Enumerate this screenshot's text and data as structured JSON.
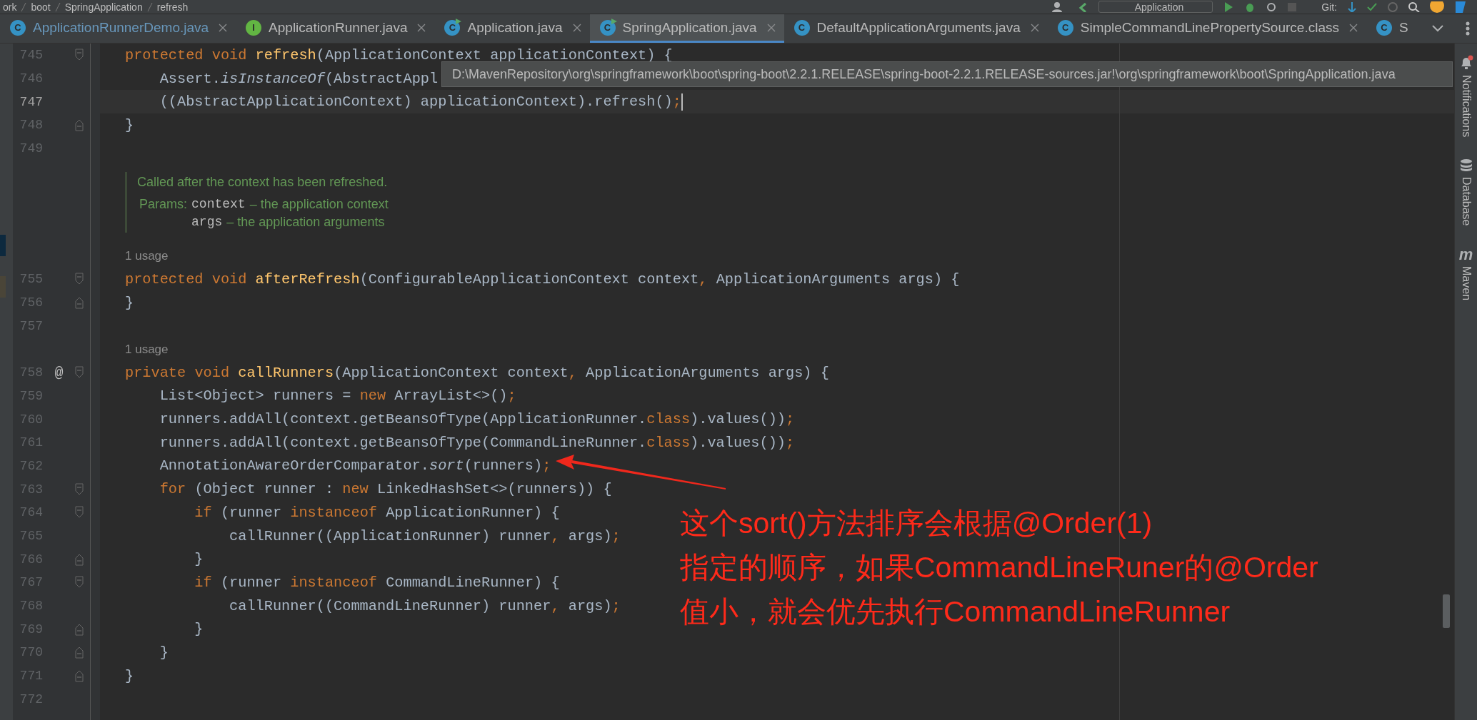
{
  "breadcrumbs": [
    "ork",
    "boot",
    "SpringApplication",
    "refresh"
  ],
  "toolbar": {
    "run_config": "Application",
    "vcs_label": "Git:"
  },
  "tabs": [
    {
      "label": "ApplicationRunnerDemo.java",
      "icon": "C",
      "kind": "class",
      "selected": false,
      "closable": true
    },
    {
      "label": "ApplicationRunner.java",
      "icon": "I",
      "kind": "interface",
      "selected": false,
      "closable": true
    },
    {
      "label": "Application.java",
      "icon": "C",
      "kind": "runnable",
      "selected": false,
      "closable": true
    },
    {
      "label": "SpringApplication.java",
      "icon": "C",
      "kind": "runnable",
      "selected": true,
      "closable": true
    },
    {
      "label": "DefaultApplicationArguments.java",
      "icon": "C",
      "kind": "class",
      "selected": false,
      "closable": true
    },
    {
      "label": "SimpleCommandLinePropertySource.class",
      "icon": "C",
      "kind": "class",
      "selected": false,
      "closable": true
    },
    {
      "label": "S",
      "icon": "C",
      "kind": "class",
      "selected": false,
      "closable": false
    }
  ],
  "tooltip": "D:\\MavenRepository\\org\\springframework\\boot\\spring-boot\\2.2.1.RELEASE\\spring-boot-2.2.1.RELEASE-sources.jar!\\org\\springframework\\boot\\SpringApplication.java",
  "editor": {
    "lines": [
      {
        "kind": "code",
        "number": "745",
        "fold_start": true,
        "fold_end": false,
        "current": false,
        "tokens": [
          {
            "kind": "keyword",
            "text": "protected "
          },
          {
            "kind": "keyword",
            "text": "void "
          },
          {
            "kind": "method",
            "text": "refresh"
          },
          {
            "kind": "plain",
            "text": "(ApplicationContext applicationContext) {"
          }
        ]
      },
      {
        "kind": "code",
        "number": "746",
        "fold_start": false,
        "fold_end": false,
        "current": false,
        "tokens": [
          {
            "kind": "plain",
            "text": "    Assert."
          },
          {
            "kind": "static",
            "text": "isInstanceOf"
          },
          {
            "kind": "plain",
            "text": "(AbstractAppl"
          }
        ]
      },
      {
        "kind": "code",
        "number": "747",
        "fold_start": false,
        "fold_end": false,
        "current": true,
        "tokens": [
          {
            "kind": "plain",
            "text": "    ((AbstractApplicationContext) applicationContext).refresh()"
          },
          {
            "kind": "keyword",
            "text": ";"
          }
        ]
      },
      {
        "kind": "code",
        "number": "748",
        "fold_start": false,
        "fold_end": true,
        "current": false,
        "tokens": [
          {
            "kind": "plain",
            "text": "}"
          }
        ]
      },
      {
        "kind": "code",
        "number": "749",
        "fold_start": false,
        "fold_end": false,
        "current": false
      },
      {
        "kind": "doc",
        "summary": "Called after the context has been refreshed.",
        "params_label": "Params:",
        "params": [
          {
            "name": "context",
            "description": "– the application context"
          },
          {
            "name": "args",
            "description": "– the application arguments"
          }
        ]
      },
      {
        "kind": "usage",
        "text": "1 usage"
      },
      {
        "kind": "code",
        "number": "755",
        "fold_start": true,
        "fold_end": false,
        "current": false,
        "tokens": [
          {
            "kind": "keyword",
            "text": "protected "
          },
          {
            "kind": "keyword",
            "text": "void "
          },
          {
            "kind": "method",
            "text": "afterRefresh"
          },
          {
            "kind": "plain",
            "text": "(ConfigurableApplicationContext context"
          },
          {
            "kind": "keyword",
            "text": ", "
          },
          {
            "kind": "plain",
            "text": "ApplicationArguments args) {"
          }
        ]
      },
      {
        "kind": "code",
        "number": "756",
        "fold_start": false,
        "fold_end": true,
        "current": false,
        "tokens": [
          {
            "kind": "plain",
            "text": "}"
          }
        ]
      },
      {
        "kind": "code",
        "number": "757",
        "fold_start": false,
        "fold_end": false,
        "current": false
      },
      {
        "kind": "usage",
        "text": "1 usage"
      },
      {
        "kind": "code",
        "number": "758",
        "mark": "@",
        "fold_start": true,
        "fold_end": false,
        "current": false,
        "tokens": [
          {
            "kind": "keyword",
            "text": "private "
          },
          {
            "kind": "keyword",
            "text": "void "
          },
          {
            "kind": "method",
            "text": "callRunners"
          },
          {
            "kind": "plain",
            "text": "(ApplicationContext context"
          },
          {
            "kind": "keyword",
            "text": ", "
          },
          {
            "kind": "plain",
            "text": "ApplicationArguments args) {"
          }
        ]
      },
      {
        "kind": "code",
        "number": "759",
        "fold_start": false,
        "fold_end": false,
        "current": false,
        "tokens": [
          {
            "kind": "plain",
            "text": "    List<Object> runners = "
          },
          {
            "kind": "keyword",
            "text": "new "
          },
          {
            "kind": "plain",
            "text": "ArrayList<>()"
          },
          {
            "kind": "keyword",
            "text": ";"
          }
        ]
      },
      {
        "kind": "code",
        "number": "760",
        "fold_start": false,
        "fold_end": false,
        "current": false,
        "tokens": [
          {
            "kind": "plain",
            "text": "    runners.addAll(context.getBeansOfType(ApplicationRunner."
          },
          {
            "kind": "keyword",
            "text": "class"
          },
          {
            "kind": "plain",
            "text": ").values())"
          },
          {
            "kind": "keyword",
            "text": ";"
          }
        ]
      },
      {
        "kind": "code",
        "number": "761",
        "fold_start": false,
        "fold_end": false,
        "current": false,
        "tokens": [
          {
            "kind": "plain",
            "text": "    runners.addAll(context.getBeansOfType(CommandLineRunner."
          },
          {
            "kind": "keyword",
            "text": "class"
          },
          {
            "kind": "plain",
            "text": ").values())"
          },
          {
            "kind": "keyword",
            "text": ";"
          }
        ]
      },
      {
        "kind": "code",
        "number": "762",
        "fold_start": false,
        "fold_end": false,
        "current": false,
        "tokens": [
          {
            "kind": "plain",
            "text": "    AnnotationAwareOrderComparator."
          },
          {
            "kind": "static",
            "text": "sort"
          },
          {
            "kind": "plain",
            "text": "(runners)"
          },
          {
            "kind": "keyword",
            "text": ";"
          }
        ]
      },
      {
        "kind": "code",
        "number": "763",
        "fold_start": true,
        "fold_end": false,
        "current": false,
        "tokens": [
          {
            "kind": "keyword",
            "text": "    for "
          },
          {
            "kind": "plain",
            "text": "(Object runner : "
          },
          {
            "kind": "keyword",
            "text": "new "
          },
          {
            "kind": "plain",
            "text": "LinkedHashSet<>(runners)) {"
          }
        ]
      },
      {
        "kind": "code",
        "number": "764",
        "fold_start": true,
        "fold_end": false,
        "current": false,
        "tokens": [
          {
            "kind": "keyword",
            "text": "        if "
          },
          {
            "kind": "plain",
            "text": "(runner "
          },
          {
            "kind": "keyword",
            "text": "instanceof "
          },
          {
            "kind": "plain",
            "text": "ApplicationRunner) {"
          }
        ]
      },
      {
        "kind": "code",
        "number": "765",
        "fold_start": false,
        "fold_end": false,
        "current": false,
        "tokens": [
          {
            "kind": "plain",
            "text": "            callRunner((ApplicationRunner) runner"
          },
          {
            "kind": "keyword",
            "text": ", "
          },
          {
            "kind": "plain",
            "text": "args)"
          },
          {
            "kind": "keyword",
            "text": ";"
          }
        ]
      },
      {
        "kind": "code",
        "number": "766",
        "fold_start": false,
        "fold_end": true,
        "current": false,
        "tokens": [
          {
            "kind": "plain",
            "text": "        }"
          }
        ]
      },
      {
        "kind": "code",
        "number": "767",
        "fold_start": true,
        "fold_end": false,
        "current": false,
        "tokens": [
          {
            "kind": "keyword",
            "text": "        if "
          },
          {
            "kind": "plain",
            "text": "(runner "
          },
          {
            "kind": "keyword",
            "text": "instanceof "
          },
          {
            "kind": "plain",
            "text": "CommandLineRunner) {"
          }
        ]
      },
      {
        "kind": "code",
        "number": "768",
        "fold_start": false,
        "fold_end": false,
        "current": false,
        "tokens": [
          {
            "kind": "plain",
            "text": "            callRunner((CommandLineRunner) runner"
          },
          {
            "kind": "keyword",
            "text": ", "
          },
          {
            "kind": "plain",
            "text": "args)"
          },
          {
            "kind": "keyword",
            "text": ";"
          }
        ]
      },
      {
        "kind": "code",
        "number": "769",
        "fold_start": false,
        "fold_end": true,
        "current": false,
        "tokens": [
          {
            "kind": "plain",
            "text": "        }"
          }
        ]
      },
      {
        "kind": "code",
        "number": "770",
        "fold_start": false,
        "fold_end": true,
        "current": false,
        "tokens": [
          {
            "kind": "plain",
            "text": "    }"
          }
        ]
      },
      {
        "kind": "code",
        "number": "771",
        "fold_start": false,
        "fold_end": true,
        "current": false,
        "tokens": [
          {
            "kind": "plain",
            "text": "}"
          }
        ]
      },
      {
        "kind": "code",
        "number": "772",
        "fold_start": false,
        "fold_end": false,
        "current": false
      }
    ]
  },
  "annotation": [
    "这个sort()方法排序会根据@Order(1)",
    "指定的顺序，如果CommandLineRuner的@Order",
    "值小，就会优先执行CommandLineRunner"
  ],
  "right_toolbar": [
    {
      "kind": "bell",
      "label": "Notifications"
    },
    {
      "kind": "database",
      "label": "Database"
    },
    {
      "kind": "maven",
      "label": "Maven",
      "icon": "m"
    }
  ]
}
